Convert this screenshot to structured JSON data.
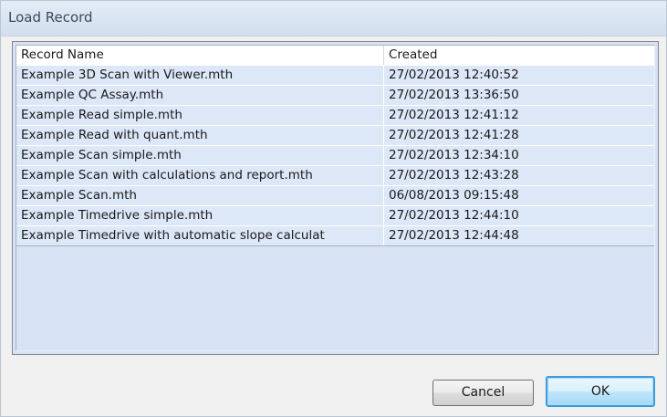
{
  "window": {
    "title": "Load Record"
  },
  "table": {
    "columns": [
      "Record Name",
      "Created"
    ],
    "rows": [
      {
        "name": "Example 3D Scan with Viewer.mth",
        "created": "27/02/2013 12:40:52"
      },
      {
        "name": "Example QC Assay.mth",
        "created": "27/02/2013 13:36:50"
      },
      {
        "name": "Example Read simple.mth",
        "created": "27/02/2013 12:41:12"
      },
      {
        "name": "Example Read with quant.mth",
        "created": "27/02/2013 12:41:28"
      },
      {
        "name": "Example Scan simple.mth",
        "created": "27/02/2013 12:34:10"
      },
      {
        "name": "Example Scan with calculations and report.mth",
        "created": "27/02/2013 12:43:28"
      },
      {
        "name": "Example Scan.mth",
        "created": "06/08/2013 09:15:48"
      },
      {
        "name": "Example Timedrive simple.mth",
        "created": "27/02/2013 12:44:10"
      },
      {
        "name": "Example Timedrive with automatic slope calculat",
        "created": "27/02/2013 12:44:48"
      }
    ]
  },
  "buttons": {
    "cancel_label": "Cancel",
    "ok_label": "OK"
  }
}
